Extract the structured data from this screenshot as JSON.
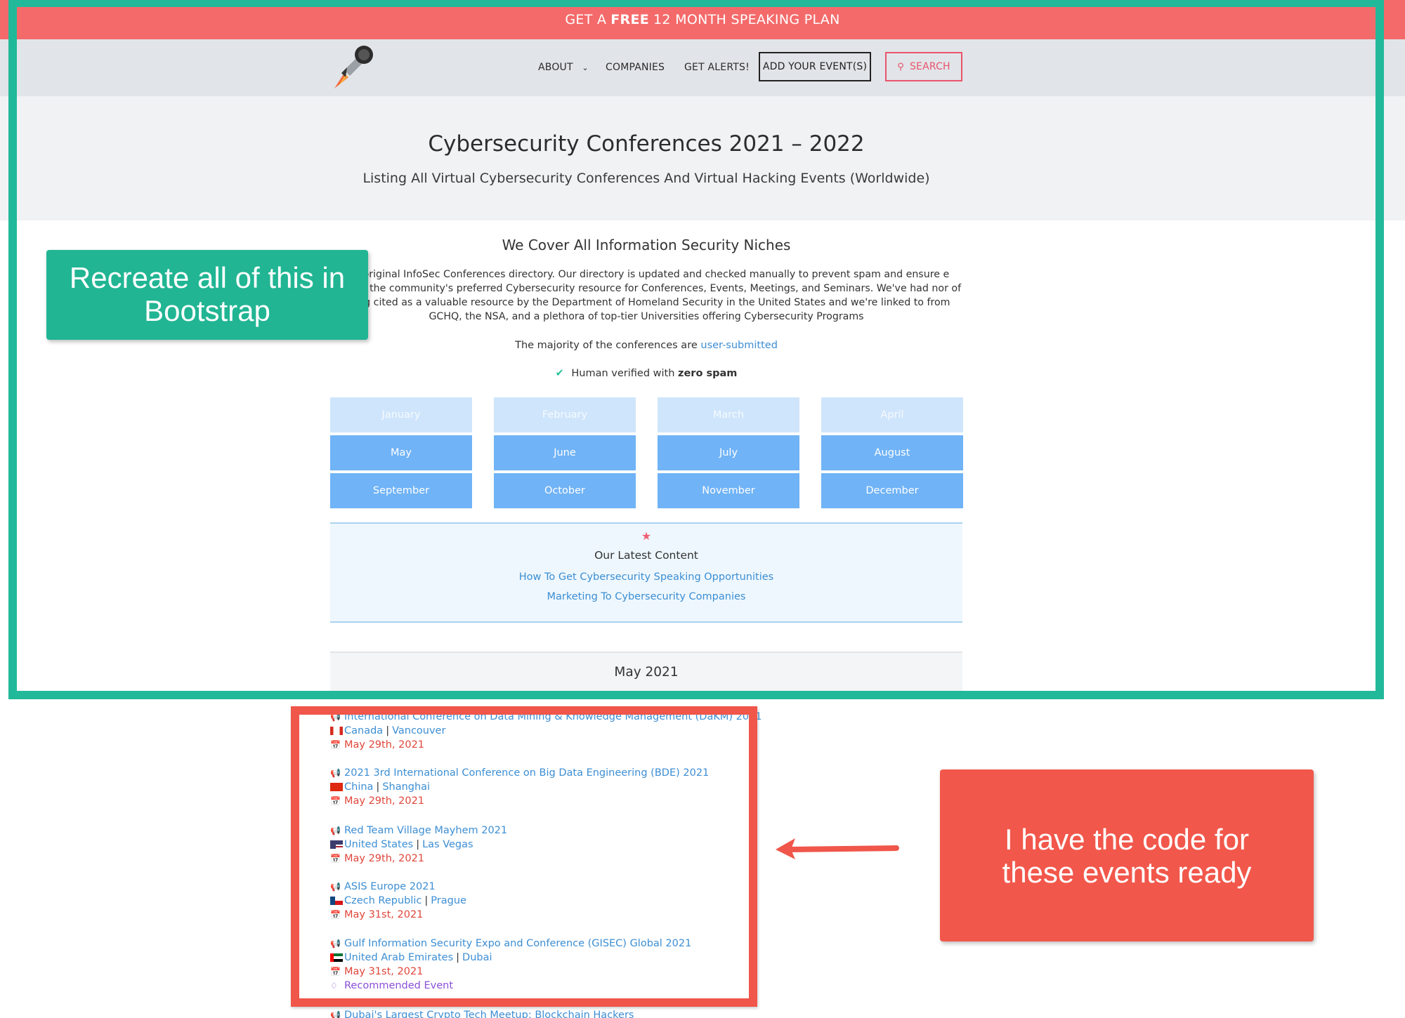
{
  "promo": {
    "prefix": "GET A",
    "bold": "FREE",
    "suffix": "12 MONTH SPEAKING PLAN"
  },
  "nav": {
    "about": "ABOUT",
    "companies": "COMPANIES",
    "alerts": "GET ALERTS!",
    "add": "ADD YOUR EVENT(S)",
    "search": "SEARCH"
  },
  "hero": {
    "title": "Cybersecurity Conferences 2021 – 2022",
    "subtitle": "Listing All Virtual Cybersecurity Conferences And Virtual Hacking Events (Worldwide)"
  },
  "niches": {
    "title": "We Cover All Information Security Niches",
    "intro": "the original InfoSec Conferences directory. Our directory is updated and checked manually to prevent spam and ensure e remain the community's preferred Cybersecurity resource for Conferences, Events, Meetings, and Seminars. We've had nor of being cited as a valuable resource by the Department of Homeland Security in the United States and we're linked to from GCHQ, the NSA, and a plethora of top-tier Universities offering Cybersecurity Programs",
    "majority_text": "The majority of the conferences are",
    "majority_link": "user-submitted",
    "verified_text": "Human verified with",
    "verified_bold": "zero spam"
  },
  "months": [
    {
      "label": "January",
      "state": "past"
    },
    {
      "label": "February",
      "state": "past"
    },
    {
      "label": "March",
      "state": "past"
    },
    {
      "label": "April",
      "state": "past"
    },
    {
      "label": "May",
      "state": "future"
    },
    {
      "label": "June",
      "state": "future"
    },
    {
      "label": "July",
      "state": "future"
    },
    {
      "label": "August",
      "state": "future"
    },
    {
      "label": "September",
      "state": "future"
    },
    {
      "label": "October",
      "state": "future"
    },
    {
      "label": "November",
      "state": "future"
    },
    {
      "label": "December",
      "state": "future"
    }
  ],
  "latest": {
    "title": "Our Latest Content",
    "links": [
      "How To Get Cybersecurity Speaking Opportunities",
      "Marketing To Cybersecurity Companies"
    ]
  },
  "month_header": "May 2021",
  "events": [
    {
      "name": "International Conference on Data Mining & Knowledge Management (DaKM) 2021",
      "country": "Canada",
      "city": "Vancouver",
      "date": "May 29th, 2021",
      "flag": "canada"
    },
    {
      "name": "2021 3rd International Conference on Big Data Engineering (BDE) 2021",
      "country": "China",
      "city": "Shanghai",
      "date": "May 29th, 2021",
      "flag": "china"
    },
    {
      "name": "Red Team Village Mayhem 2021",
      "country": "United States",
      "city": "Las Vegas",
      "date": "May 29th, 2021",
      "flag": "usa"
    },
    {
      "name": "ASIS Europe 2021",
      "country": "Czech Republic",
      "city": "Prague",
      "date": "May 31st, 2021",
      "flag": "czech"
    },
    {
      "name": "Gulf Information Security Expo and Conference (GISEC) Global 2021",
      "country": "United Arab Emirates",
      "city": "Dubai",
      "date": "May 31st, 2021",
      "flag": "uae",
      "badge": "Recommended Event"
    },
    {
      "name": "Dubai's Largest Crypto Tech Meetup: Blockchain Hackers"
    }
  ],
  "annotations": {
    "green": "Recreate all of this in Bootstrap",
    "red": "I have the code for these events ready"
  },
  "colors": {
    "promo": "#f46a6a",
    "green": "#22b99a",
    "red": "#f0564a",
    "link": "#3c8ed3",
    "date": "#e0463a"
  }
}
